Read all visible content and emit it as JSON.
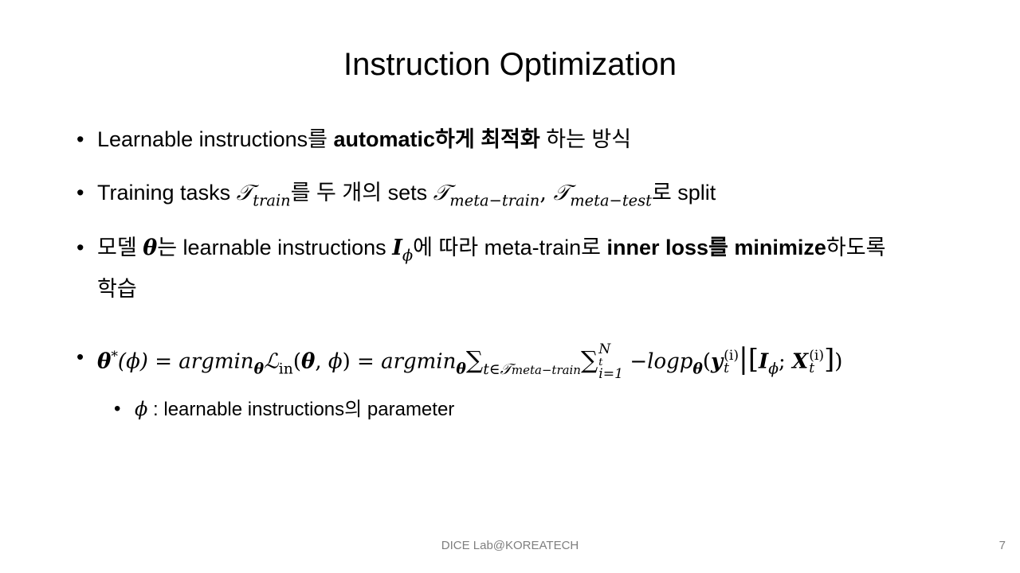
{
  "title": "Instruction Optimization",
  "bullet_char": "•",
  "bullets": [
    {
      "t1": "Learnable instructions를 ",
      "t2_bold": "automatic하게 최적화",
      "t3": " 하는 방식"
    },
    {
      "t1": "Training tasks ",
      "T_symbol": "𝒯",
      "train_sub": "train",
      "t2": "를 두 개의 sets ",
      "meta_train_sub": "meta−train",
      "comma": ", ",
      "meta_test_sub": "meta−test",
      "t3": "로 split"
    },
    {
      "t1": "모델 ",
      "theta": "θ",
      "t2": "는 learnable instructions ",
      "I": "I",
      "phi": "ϕ",
      "t3": "에 따라 meta-train로 ",
      "t4_bold": "inner loss를 minimize",
      "t5": "하도록",
      "t6": "학습"
    }
  ],
  "equation": {
    "theta": "θ",
    "star": "*",
    "phi_arg": "(ϕ)",
    "eq": " = ",
    "argmin": "argmin",
    "L": "ℒ",
    "in_sub": "in",
    "lparen": "(",
    "comma": ", ",
    "phi": "ϕ",
    "rparen": ")",
    "sum": "∑",
    "sum1_sub_t": "t∈",
    "T": "𝒯",
    "meta_train": "meta−train",
    "sum2_upper": "N",
    "sum2_upper_sub": "t",
    "sum2_lower": "i=1",
    "minus_log": " −log",
    "p": "p",
    "y": "y",
    "sup_i": "(i)",
    "t_sub": "t",
    "bar": "|",
    "lbracket": "[",
    "I": "I",
    "semicolon": "; ",
    "X": "X",
    "rbracket": "]"
  },
  "sub_bullet": {
    "bullet_char": "•",
    "phi": "ϕ",
    "text": " : learnable instructions의 parameter"
  },
  "footer": "DICE  Lab@KOREATECH",
  "page_number": "7"
}
